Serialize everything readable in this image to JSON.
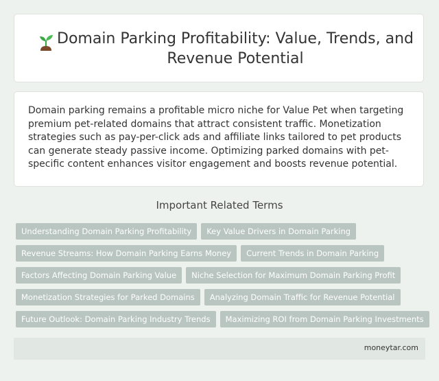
{
  "header": {
    "icon": "sprout-icon",
    "title": "Domain Parking Profitability: Value, Trends, and Revenue Potential"
  },
  "summary": {
    "text": "Domain parking remains a profitable micro niche for Value Pet when targeting premium pet-related domains that attract consistent traffic. Monetization strategies such as pay-per-click ads and affiliate links tailored to pet products can generate steady passive income. Optimizing parked domains with pet-specific content enhances visitor engagement and boosts revenue potential."
  },
  "related": {
    "heading": "Important Related Terms",
    "tags": [
      "Understanding Domain Parking Profitability",
      "Key Value Drivers in Domain Parking",
      "Revenue Streams: How Domain Parking Earns Money",
      "Current Trends in Domain Parking",
      "Factors Affecting Domain Parking Value",
      "Niche Selection for Maximum Domain Parking Profit",
      "Monetization Strategies for Parked Domains",
      "Analyzing Domain Traffic for Revenue Potential",
      "Future Outlook: Domain Parking Industry Trends",
      "Maximizing ROI from Domain Parking Investments"
    ]
  },
  "footer": {
    "site": "moneytar.com"
  },
  "colors": {
    "background": "#eef2ef",
    "tag_background": "#b9c5c0",
    "footer_background": "#e1e7e2",
    "sprout_leaf": "#3aa845",
    "sprout_soil": "#7a4a2a"
  }
}
